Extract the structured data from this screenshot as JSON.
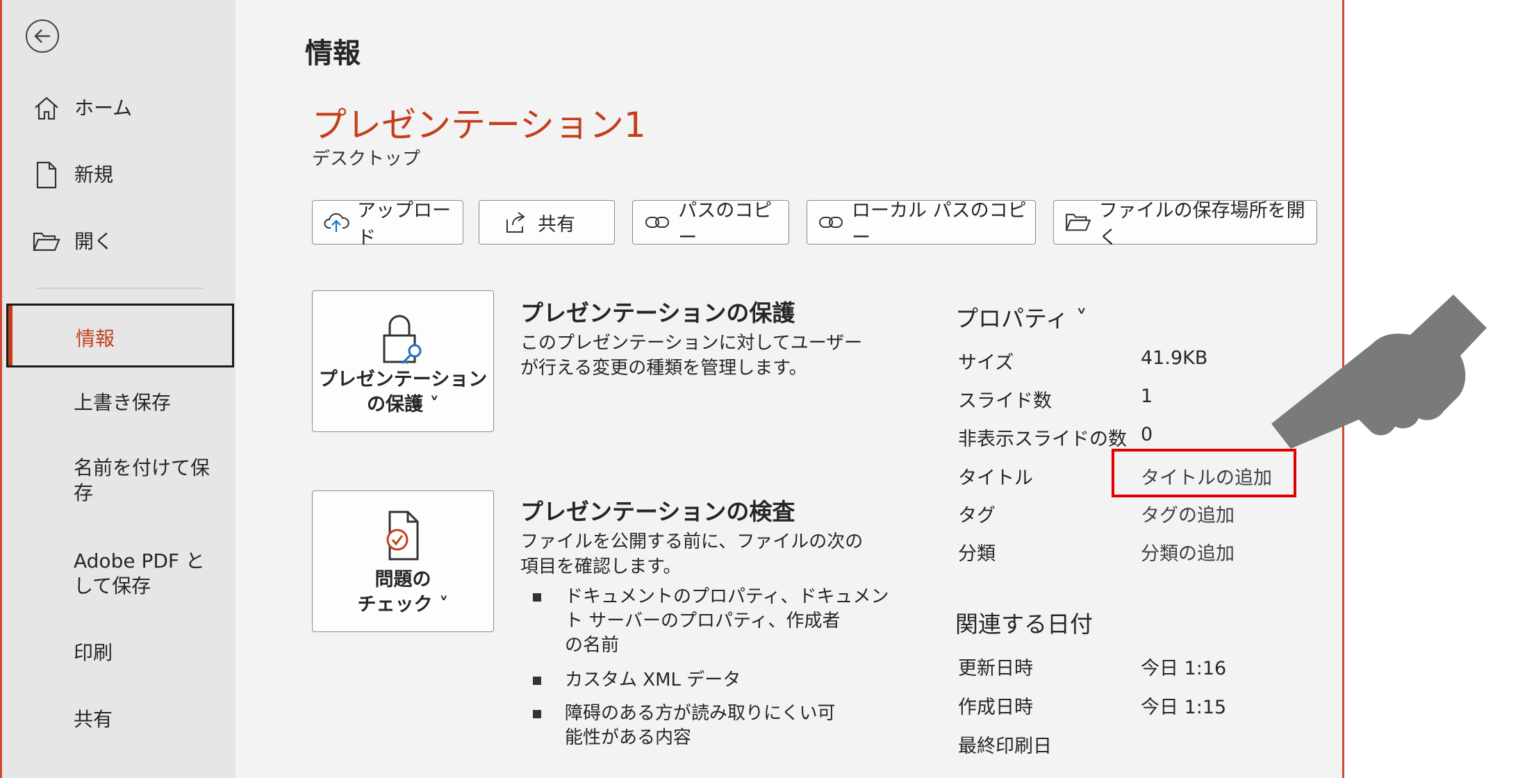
{
  "sidebar": {
    "items": [
      {
        "label": "ホーム",
        "icon": "home-icon"
      },
      {
        "label": "新規",
        "icon": "new-document-icon"
      },
      {
        "label": "開く",
        "icon": "open-folder-icon"
      }
    ],
    "active": "情報",
    "lower_items": [
      "上書き保存",
      "名前を付けて保\n存",
      "Adobe PDF と\nして保存",
      "印刷",
      "共有"
    ]
  },
  "main": {
    "page_title": "情報",
    "doc_title": "プレゼンテーション1",
    "doc_location": "デスクトップ",
    "buttons": [
      {
        "label": "アップロード",
        "icon": "cloud-upload-icon"
      },
      {
        "label": "共有",
        "icon": "share-icon"
      },
      {
        "label": "パスのコピー",
        "icon": "link-icon"
      },
      {
        "label": "ローカル パスのコピー",
        "icon": "link-icon"
      },
      {
        "label": "ファイルの保存場所を開く",
        "icon": "open-folder-icon"
      }
    ],
    "protect": {
      "button_label": "プレゼンテーション\nの保護 ˅",
      "heading": "プレゼンテーションの保護",
      "desc": "このプレゼンテーションに対してユーザー\nが行える変更の種類を管理します。"
    },
    "inspect": {
      "button_label": "問題の\nチェック ˅",
      "heading": "プレゼンテーションの検査",
      "desc": "ファイルを公開する前に、ファイルの次の\n項目を確認します。",
      "bullets": [
        "ドキュメントのプロパティ、ドキュメン\nト サーバーのプロパティ、作成者\nの名前",
        "カスタム XML データ",
        "障碍のある方が読み取りにくい可\n能性がある内容"
      ]
    }
  },
  "properties": {
    "heading": "プロパティ ˅",
    "rows": [
      {
        "label": "サイズ",
        "value": "41.9KB"
      },
      {
        "label": "スライド数",
        "value": "1"
      },
      {
        "label": "非表示スライドの数",
        "value": "0"
      },
      {
        "label": "タイトル",
        "value": "タイトルの追加"
      },
      {
        "label": "タグ",
        "value": "タグの追加"
      },
      {
        "label": "分類",
        "value": "分類の追加"
      }
    ]
  },
  "dates": {
    "heading": "関連する日付",
    "rows": [
      {
        "label": "更新日時",
        "value": "今日 1:16"
      },
      {
        "label": "作成日時",
        "value": "今日 1:15"
      },
      {
        "label": "最終印刷日",
        "value": ""
      }
    ]
  },
  "colors": {
    "accent": "#c43e1c",
    "highlight": "#e00000",
    "sidebar_bg": "#e6e6e6",
    "main_bg": "#f3f3f3"
  }
}
